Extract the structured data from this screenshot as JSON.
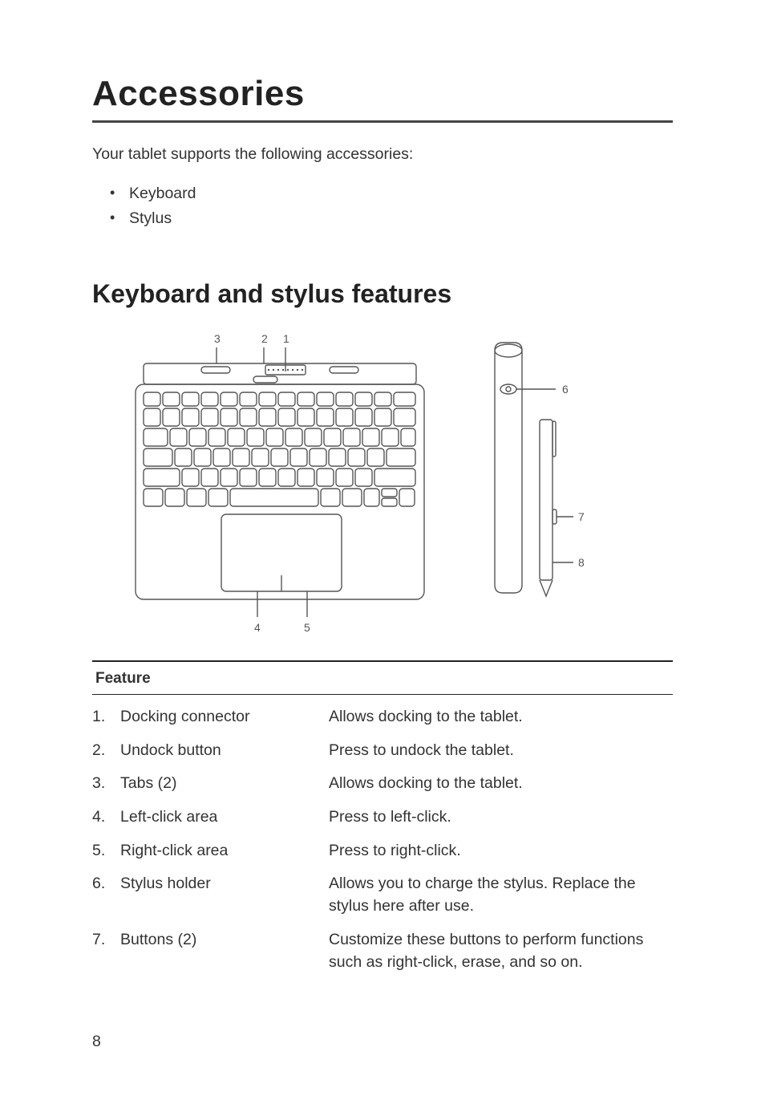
{
  "page": {
    "title": "Accessories",
    "intro": "Your tablet supports the following accessories:",
    "accessories": [
      "Keyboard",
      "Stylus"
    ],
    "section_title": "Keyboard and stylus features",
    "feature_header": "Feature",
    "features": [
      {
        "num": "1.",
        "name": "Docking connector",
        "desc": "Allows docking to the tablet."
      },
      {
        "num": "2.",
        "name": "Undock button",
        "desc": "Press to undock the tablet."
      },
      {
        "num": "3.",
        "name": "Tabs (2)",
        "desc": "Allows docking to the tablet."
      },
      {
        "num": "4.",
        "name": "Left-click area",
        "desc": "Press to left-click."
      },
      {
        "num": "5.",
        "name": "Right-click area",
        "desc": "Press to right-click."
      },
      {
        "num": "6.",
        "name": "Stylus holder",
        "desc": "Allows you to charge the stylus. Replace the stylus here after use."
      },
      {
        "num": "7.",
        "name": "Buttons (2)",
        "desc": "Customize these buttons to perform functions such as right-click, erase, and so on."
      }
    ],
    "page_number": "8",
    "diagram": {
      "callouts_keyboard": [
        "1",
        "2",
        "3",
        "4",
        "5"
      ],
      "callouts_stylus": [
        "6",
        "7",
        "8"
      ]
    }
  }
}
